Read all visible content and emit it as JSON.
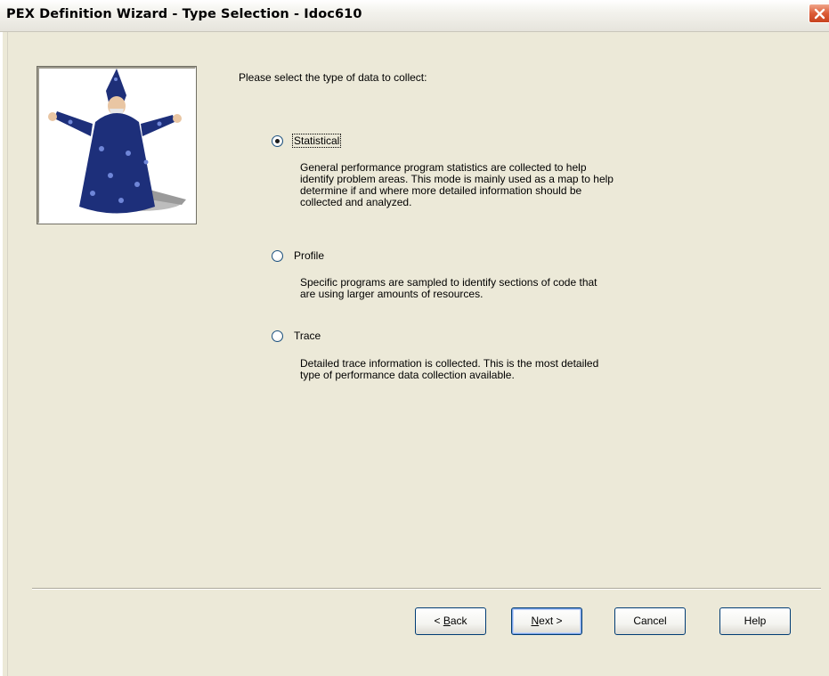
{
  "window": {
    "title": "PEX Definition Wizard - Type Selection - Idoc610"
  },
  "prompt": "Please select the type of data to collect:",
  "options": [
    {
      "label": "Statistical",
      "selected": true,
      "description": [
        "General performance program statistics are collected to help",
        "identify problem areas.  This mode is mainly used as a map to help",
        "determine if and where more detailed information should be",
        "collected and analyzed."
      ]
    },
    {
      "label": "Profile",
      "selected": false,
      "description": [
        "Specific programs are sampled to identify sections of code that",
        "are using larger amounts of resources."
      ]
    },
    {
      "label": "Trace",
      "selected": false,
      "description": [
        "Detailed trace information is collected.  This is the most detailed",
        "type of performance data collection available."
      ]
    }
  ],
  "buttons": {
    "back_prefix": "< ",
    "back_mnemonic": "B",
    "back_rest": "ack",
    "next_mnemonic": "N",
    "next_rest": "ext >",
    "cancel": "Cancel",
    "help": "Help"
  },
  "icons": {
    "close": "close-icon",
    "wizard": "wizard-image"
  },
  "colors": {
    "dialog_bg": "#ece9d8",
    "close_button": "#dc5c37",
    "button_border": "#003c74"
  }
}
